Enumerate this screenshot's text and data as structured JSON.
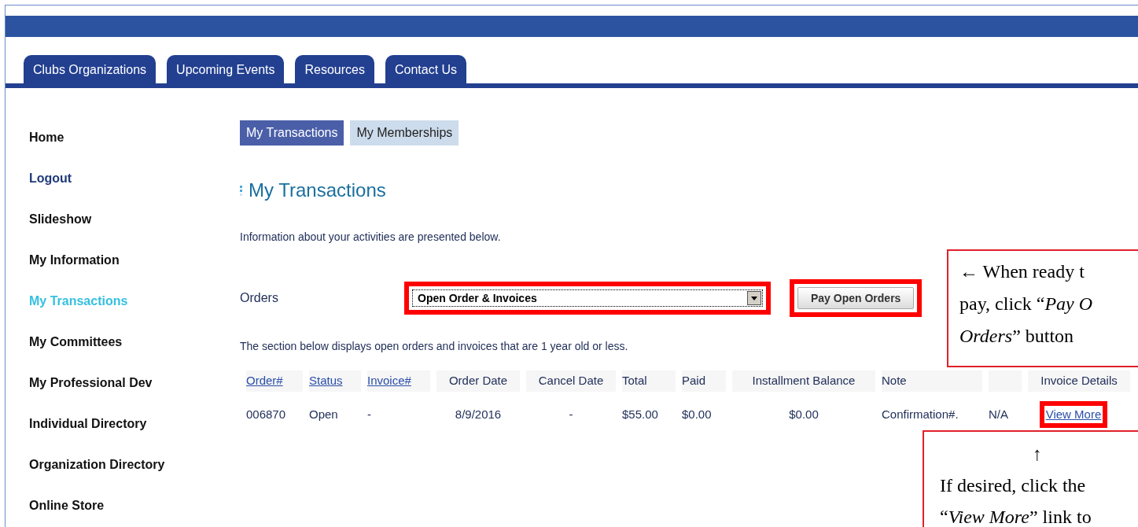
{
  "nav_tabs": [
    {
      "label": "Clubs Organizations"
    },
    {
      "label": "Upcoming Events"
    },
    {
      "label": "Resources"
    },
    {
      "label": "Contact Us"
    }
  ],
  "sidebar": {
    "items": [
      {
        "label": "Home",
        "kind": "page",
        "selected": false
      },
      {
        "label": "Logout",
        "kind": "action",
        "selected": false
      },
      {
        "label": "Slideshow",
        "kind": "page",
        "selected": false
      },
      {
        "label": "My Information",
        "kind": "page",
        "selected": false
      },
      {
        "label": "My Transactions",
        "kind": "page",
        "selected": true
      },
      {
        "label": "My Committees",
        "kind": "page",
        "selected": false
      },
      {
        "label": "My Professional Dev",
        "kind": "page",
        "selected": false
      },
      {
        "label": "Individual Directory",
        "kind": "page",
        "selected": false
      },
      {
        "label": "Organization Directory",
        "kind": "page",
        "selected": false
      },
      {
        "label": "Online Store",
        "kind": "page",
        "selected": false
      }
    ]
  },
  "sub_tabs": [
    {
      "label": "My Transactions",
      "selected": true
    },
    {
      "label": "My Memberships",
      "selected": false
    }
  ],
  "heading": "My Transactions",
  "intro": "Information about your activities are presented below.",
  "orders": {
    "label": "Orders",
    "value": "Open Order & Invoices",
    "button": "Pay Open Orders"
  },
  "section_note": "The section below displays open orders and invoices that are 1 year old or less.",
  "table": {
    "columns": [
      {
        "kind": "link",
        "label": "Order#"
      },
      {
        "kind": "link",
        "label": "Status"
      },
      {
        "kind": "link",
        "label": "Invoice#"
      },
      {
        "kind": "text",
        "label": "Order Date"
      },
      {
        "kind": "text",
        "label": "Cancel Date"
      },
      {
        "kind": "text",
        "label": "Total"
      },
      {
        "kind": "text",
        "label": "Paid"
      },
      {
        "kind": "text",
        "label": "Installment Balance"
      },
      {
        "kind": "text",
        "label": "Note"
      },
      {
        "kind": "blank"
      },
      {
        "kind": "text",
        "label": "Invoice Details"
      }
    ],
    "rows": [
      {
        "cells": [
          {
            "kind": "text",
            "text": "006870"
          },
          {
            "kind": "text",
            "text": "Open"
          },
          {
            "kind": "text",
            "text": "-"
          },
          {
            "kind": "text",
            "text": "8/9/2016"
          },
          {
            "kind": "text",
            "text": "-"
          },
          {
            "kind": "text",
            "text": "$55.00"
          },
          {
            "kind": "text",
            "text": "$0.00"
          },
          {
            "kind": "text",
            "text": "$0.00"
          },
          {
            "kind": "text",
            "text": "Confirmation#."
          },
          {
            "kind": "text",
            "text": "N/A"
          },
          {
            "kind": "link",
            "text": "View More"
          }
        ]
      }
    ]
  },
  "callouts": [
    {
      "lines": [
        "← When ready t",
        "pay, click “*Pay O*",
        "*Orders*” button"
      ]
    },
    {
      "lines": [
        "↑",
        "If desired, click the",
        "“*View More*” link to"
      ]
    }
  ]
}
